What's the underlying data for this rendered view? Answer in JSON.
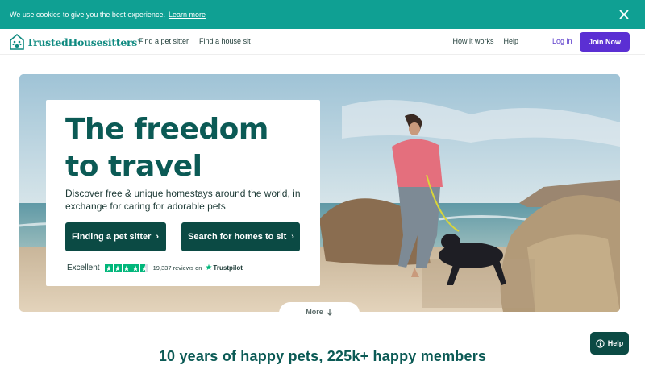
{
  "cookie_bar": {
    "text": "We use cookies to give you the best experience.",
    "link": "Learn more"
  },
  "header": {
    "logo_text": "TrustedHousesitters",
    "logo_tm": "™",
    "nav_left": [
      "Find a pet sitter",
      "Find a house sit"
    ],
    "nav_right": [
      "How it works",
      "Help"
    ],
    "login": "Log in",
    "join": "Join Now"
  },
  "hero": {
    "title": "The freedom to travel",
    "subtitle": "Discover free & unique homestays around the world, in exchange for caring for adorable pets",
    "cta_primary": "Finding a pet sitter",
    "cta_secondary": "Search for homes to sit",
    "rating_label": "Excellent",
    "rating_stars": 4.6,
    "reviews": "19,337 reviews on",
    "trustpilot": "Trustpilot"
  },
  "more": "More",
  "stats_heading": "10 years of happy pets, 225k+ happy members",
  "help": "Help",
  "colors": {
    "teal": "#0fa093",
    "dark_green": "#0b4a44",
    "heading_green": "#0b5a55",
    "purple": "#5b2fd3",
    "trustpilot_green": "#00b67a"
  }
}
